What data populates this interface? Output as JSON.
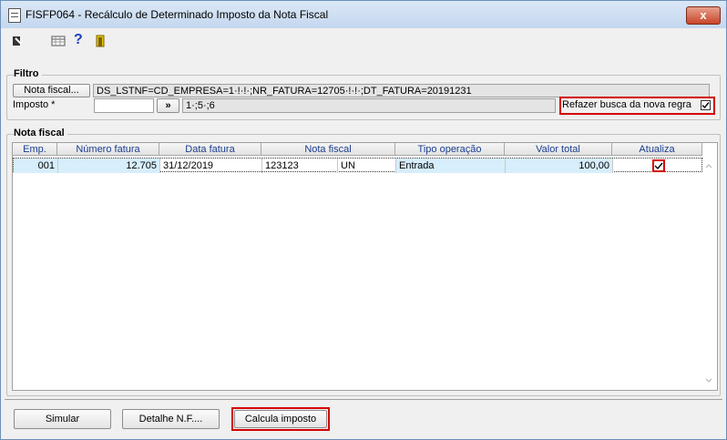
{
  "window": {
    "title": "FISFP064 - Recálculo de Determinado Imposto da Nota Fiscal",
    "close_label": "x"
  },
  "toolbar": {
    "help_label": "?"
  },
  "filtro": {
    "group_label": "Filtro",
    "nota_button": "Nota fiscal...",
    "nota_value": "DS_LSTNF=CD_EMPRESA=1·!·!·;NR_FATURA=12705·!·!·;DT_FATURA=20191231",
    "imposto_label": "Imposto *",
    "imposto_input": "",
    "lookup_button": "»",
    "imposto_value": "1·;5·;6",
    "refazer_label": "Refazer busca da nova regra",
    "refazer_checked": true
  },
  "nota": {
    "group_label": "Nota fiscal",
    "columns": [
      "Emp.",
      "Número fatura",
      "Data fatura",
      "Nota fiscal",
      "Tipo operação",
      "Valor total",
      "Atualiza"
    ],
    "rows": [
      {
        "emp": "001",
        "numero": "12.705",
        "data": "31/12/2019",
        "nota": "123123",
        "serie": "UN",
        "tipo": "Entrada",
        "valor": "100,00",
        "atualiza": true
      }
    ]
  },
  "buttons": {
    "simular": "Simular",
    "detalhe": "Detalhe N.F....",
    "calcula": "Calcula imposto"
  },
  "colors": {
    "highlight": "#d40000",
    "selected_row": "#d7eefc",
    "header_text": "#1b3d8f"
  }
}
